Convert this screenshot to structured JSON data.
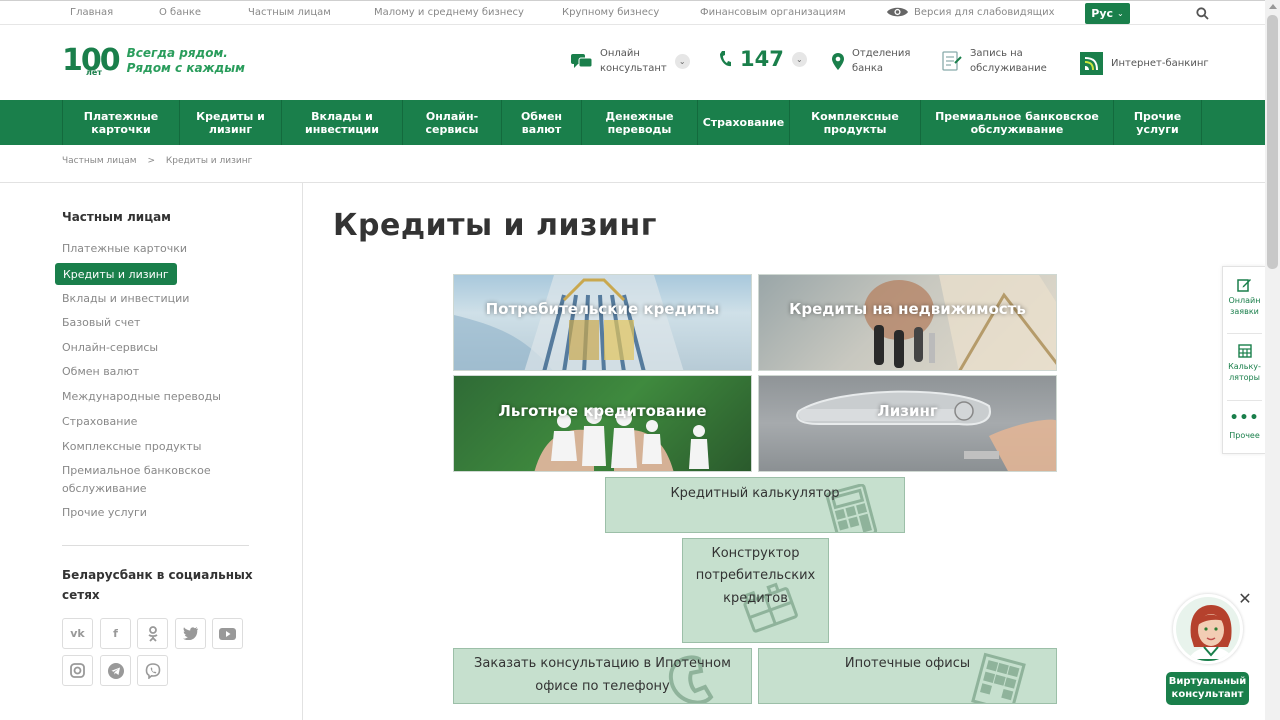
{
  "topbar": {
    "links": [
      "Главная",
      "О банке",
      "Частным лицам",
      "Малому и среднему бизнесу",
      "Крупному бизнесу",
      "Финансовым организациям"
    ],
    "low_vision": "Версия для слабовидящих",
    "language": "Рус"
  },
  "header": {
    "logo_number": "100",
    "logo_sub": "лет",
    "slogan_line1": "Всегда рядом.",
    "slogan_line2": "Рядом с каждым",
    "online_consultant_1": "Онлайн",
    "online_consultant_2": "консультант",
    "phone": "147",
    "branches_1": "Отделения",
    "branches_2": "банка",
    "appointment_1": "Запись на",
    "appointment_2": "обслуживание",
    "internet_banking": "Интернет-банкинг"
  },
  "nav": [
    {
      "l1": "Платежные",
      "l2": "карточки"
    },
    {
      "l1": "Кредиты и",
      "l2": "лизинг"
    },
    {
      "l1": "Вклады и",
      "l2": "инвестиции"
    },
    {
      "l1": "Онлайн-",
      "l2": "сервисы"
    },
    {
      "l1": "Обмен",
      "l2": "валют"
    },
    {
      "l1": "Денежные",
      "l2": "переводы"
    },
    {
      "l1": "Страхование",
      "l2": ""
    },
    {
      "l1": "Комплексные",
      "l2": "продукты"
    },
    {
      "l1": "Премиальное банковское",
      "l2": "обслуживание"
    },
    {
      "l1": "Прочие",
      "l2": "услуги"
    }
  ],
  "breadcrumb": {
    "home": "Частным лицам",
    "sep": ">",
    "current": "Кредиты и лизинг"
  },
  "sidebar": {
    "title": "Частным лицам",
    "items": [
      "Платежные карточки",
      "Кредиты и лизинг",
      "Вклады и инвестиции",
      "Базовый счет",
      "Онлайн-сервисы",
      "Обмен валют",
      "Международные переводы",
      "Страхование",
      "Комплексные продукты",
      "Премиальное банковское",
      "обслуживание",
      "Прочие услуги"
    ],
    "social_title": "Беларусбанк в социальных сетях",
    "social": [
      "vk",
      "facebook",
      "odnoklassniki",
      "twitter",
      "youtube",
      "instagram",
      "telegram",
      "viber"
    ]
  },
  "main": {
    "title": "Кредиты и лизинг",
    "tiles": [
      "Потребительские кредиты",
      "Кредиты на недвижимость",
      "Льготное кредитование",
      "Лизинг"
    ],
    "calculator": "Кредитный калькулятор",
    "constructor_1": "Конструктор",
    "constructor_2": "потребительских",
    "constructor_3": "кредитов",
    "consult_1": "Заказать консультацию в Ипотечном",
    "consult_2": "офисе по телефону",
    "mortgage_offices": "Ипотечные офисы"
  },
  "right_panel": {
    "apps_1": "Онлайн",
    "apps_2": "заявки",
    "calc_1": "Кальку-",
    "calc_2": "ляторы",
    "other": "Прочее"
  },
  "virtual_consultant": {
    "line1": "Виртуальный",
    "line2": "консультант"
  },
  "colors": {
    "brand": "#1a7f4b",
    "tile_green": "#c6e0ce"
  }
}
